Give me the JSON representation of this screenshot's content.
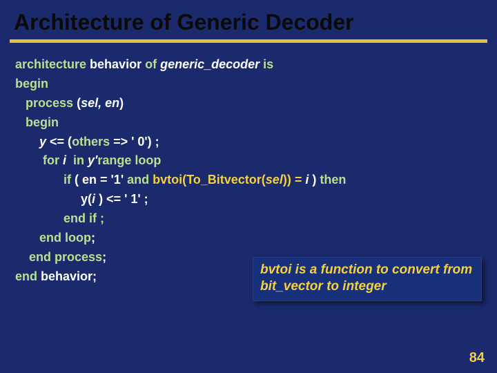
{
  "title": "Architecture of Generic Decoder",
  "code": {
    "l1a": "architecture",
    "l1b": " behavior ",
    "l1c": "of",
    "l1d": " generic_decoder ",
    "l1e": "is",
    "l2": "begin",
    "l3a": "process",
    "l3b": " (",
    "l3c": "sel, en",
    "l3d": ")",
    "l4": "begin",
    "l5a": "y ",
    "l5b": "<= (",
    "l5c": "others",
    "l5d": " => ' 0') ;",
    "l6a": "for ",
    "l6b": "i  ",
    "l6c": "in",
    "l6d": " y'",
    "l6e": "range loop",
    "l7a": "if",
    "l7b": " ( en = '1' ",
    "l7c": "and",
    "l7d": " bvtoi(To_Bitvector(",
    "l7e": "sel",
    "l7f": ")) = ",
    "l7g": "i",
    "l7h": " ) ",
    "l7i": "then",
    "l8a": "y(",
    "l8b": "i ",
    "l8c": ") <= ' 1' ;",
    "l9": "end if ;",
    "l10a": "end loop",
    "l10b": ";",
    "l11a": "end process",
    "l11b": ";",
    "l12a": "end ",
    "l12b": "behavior;"
  },
  "callout": "bvtoi is a function to convert from bit_vector to integer",
  "pagenum": "84"
}
